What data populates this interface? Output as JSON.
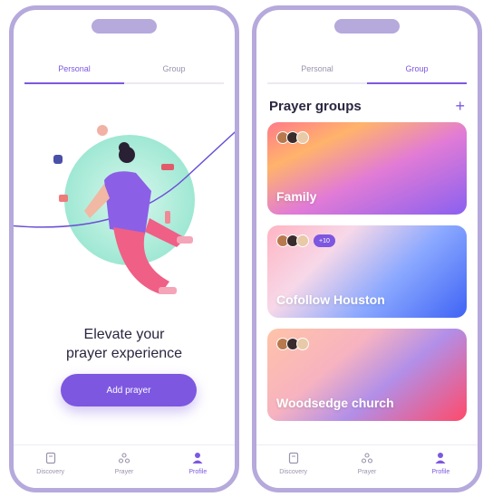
{
  "colors": {
    "accent": "#7d57e0",
    "frame": "#b6a9dc",
    "text": "#2b2640",
    "muted": "#9a92ae"
  },
  "left_screen": {
    "tabs": [
      {
        "label": "Personal",
        "active": true
      },
      {
        "label": "Group",
        "active": false
      }
    ],
    "headline_line1": "Elevate your",
    "headline_line2": "prayer experience",
    "add_button": "Add prayer"
  },
  "right_screen": {
    "tabs": [
      {
        "label": "Personal",
        "active": false
      },
      {
        "label": "Group",
        "active": true
      }
    ],
    "title": "Prayer groups",
    "plus_icon": "plus-icon",
    "groups": [
      {
        "name": "Family",
        "badge": ""
      },
      {
        "name": "Cofollow Houston",
        "badge": "+10"
      },
      {
        "name": "Woodsedge church",
        "badge": ""
      }
    ]
  },
  "bottom_nav": [
    {
      "label": "Discovery",
      "icon": "book-icon",
      "active": false
    },
    {
      "label": "Prayer",
      "icon": "people-icon",
      "active": false
    },
    {
      "label": "Profile",
      "icon": "user-icon",
      "active": true
    }
  ]
}
